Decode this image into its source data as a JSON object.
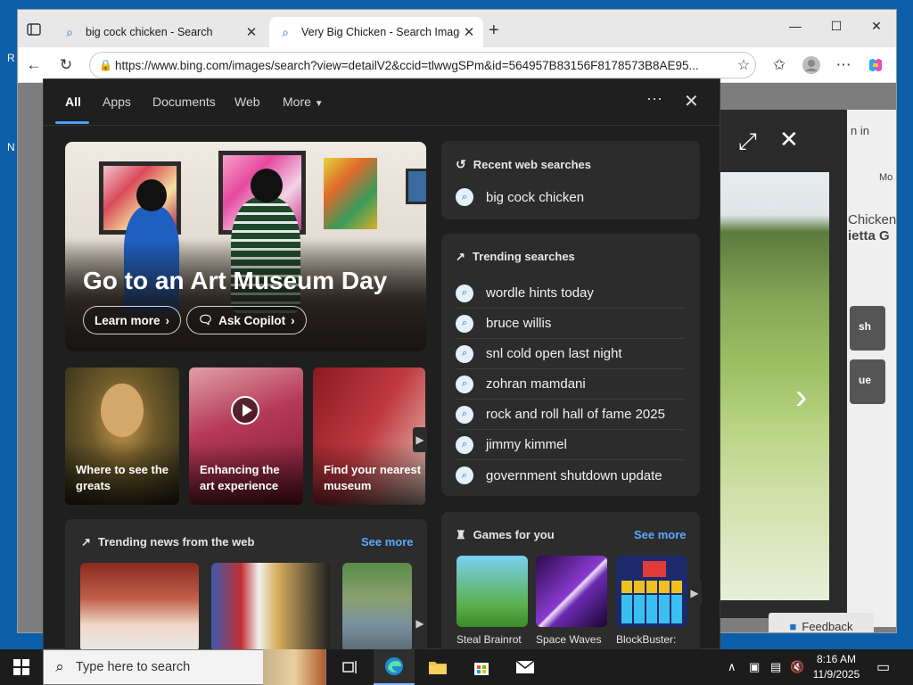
{
  "browser": {
    "tabs": [
      {
        "title": "big cock chicken - Search",
        "icon": "search-icon"
      },
      {
        "title": "Very Big Chicken - Search Images",
        "icon": "search-icon"
      }
    ],
    "url": "https://www.bing.com/images/search?view=detailV2&ccid=tlwwgSPm&id=564957B83156F8178573B8AE95..."
  },
  "page_behind": {
    "fragments": [
      "n in",
      "Chicken",
      "ietta G",
      "sh",
      "ue",
      "Mo"
    ],
    "feedback_label": "Feedback"
  },
  "flyout": {
    "nav": [
      "All",
      "Apps",
      "Documents",
      "Web",
      "More"
    ],
    "hero": {
      "title": "Go to an Art Museum Day",
      "learn_more": "Learn more",
      "ask_copilot": "Ask Copilot"
    },
    "tiles": [
      {
        "caption1": "Where to see the",
        "caption2": "greats"
      },
      {
        "caption1": "Enhancing the",
        "caption2": "art experience"
      },
      {
        "caption1": "Find your nearest",
        "caption2": "museum"
      }
    ],
    "recent": {
      "heading": "Recent web searches",
      "items": [
        "big cock chicken"
      ]
    },
    "trending": {
      "heading": "Trending searches",
      "items": [
        "wordle hints today",
        "bruce willis",
        "snl cold open last night",
        "zohran mamdani",
        "rock and roll hall of fame 2025",
        "jimmy kimmel",
        "government shutdown update"
      ]
    },
    "news": {
      "heading": "Trending news from the web",
      "see_more": "See more"
    },
    "games": {
      "heading": "Games for you",
      "see_more": "See more",
      "items": [
        "Steal Brainrot",
        "Space Waves",
        "BlockBuster:"
      ]
    }
  },
  "taskbar": {
    "search_placeholder": "Type here to search",
    "time": "8:16 AM",
    "date": "11/9/2025"
  }
}
